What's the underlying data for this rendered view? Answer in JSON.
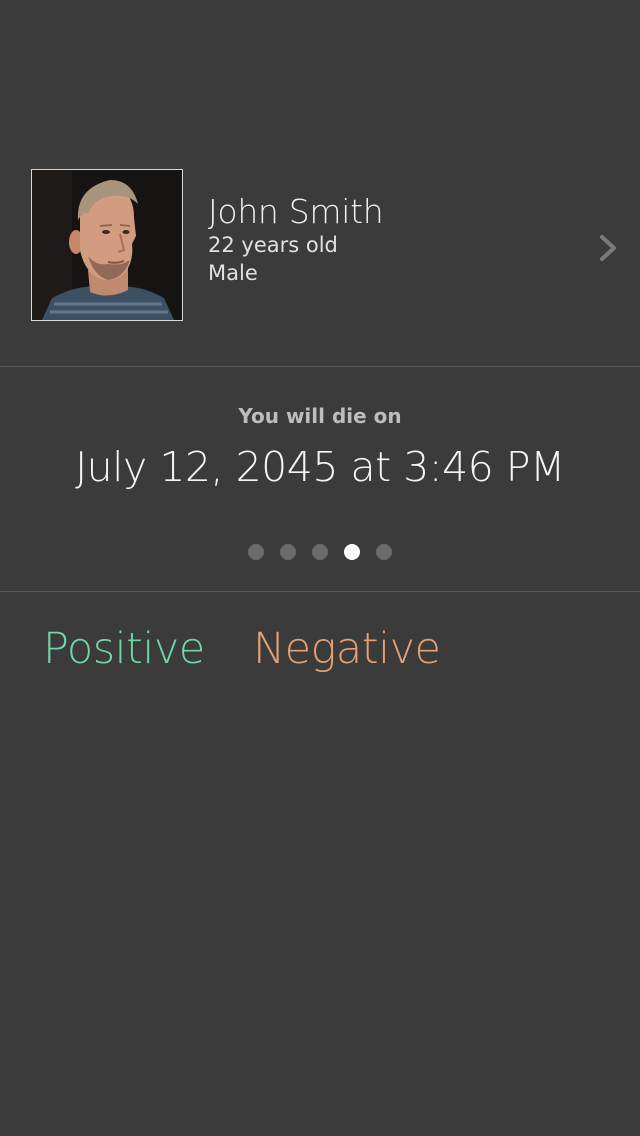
{
  "profile": {
    "name": "John Smith",
    "age": "22 years old",
    "sex": "Male",
    "avatar_icon": "user-photo"
  },
  "prediction": {
    "caption": "You will die on",
    "date": "July 12, 2045 at 3:46 PM"
  },
  "pager": {
    "total": 5,
    "active_index": 3
  },
  "tabs": [
    {
      "label": "Positive",
      "color": "#6fd6a4"
    },
    {
      "label": "Negative",
      "color": "#e5a073"
    }
  ],
  "colors": {
    "background": "#3b3b3b",
    "divider": "#595959",
    "dot_inactive": "#6b6b6b",
    "dot_active": "#ffffff"
  }
}
